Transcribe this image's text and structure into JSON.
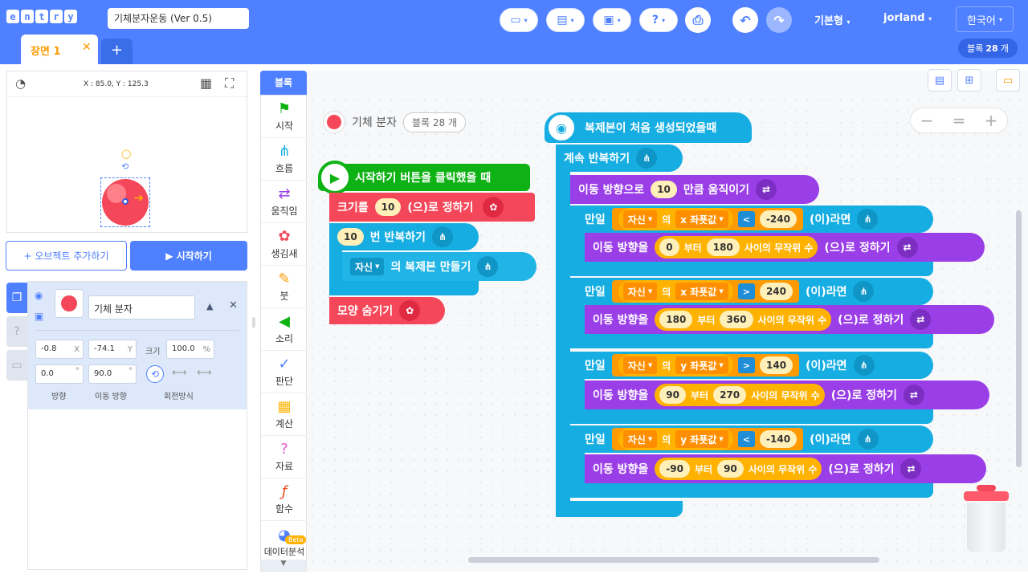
{
  "app": {
    "logo_letters": [
      "e",
      "n",
      "t",
      "r",
      "y"
    ],
    "project_title": "기체분자운동 (Ver 0.5)"
  },
  "topbar": {
    "mode_label": "기본형",
    "user_label": "jorland",
    "lang_label": "한국어",
    "help_label": "?"
  },
  "scene": {
    "tab_label": "장면 1",
    "add_label": "+",
    "block_count_prefix": "블록",
    "block_count": "28",
    "block_count_suffix": "개"
  },
  "stage": {
    "coords": "X : 85.0, Y : 125.3"
  },
  "buttons": {
    "add_object": "+ 오브젝트 추가하기",
    "start": "▶ 시작하기"
  },
  "object": {
    "name": "기체 분자",
    "x": "-0.8",
    "x_label": "X",
    "y": "-74.1",
    "y_label": "Y",
    "size_label": "크기",
    "size": "100.0",
    "size_unit": "%",
    "direction": "0.0",
    "move_direction": "90.0",
    "deg": "°",
    "direction_label": "방향",
    "move_direction_label": "이동 방향",
    "rotation_label": "회전방식"
  },
  "palette": {
    "header": "블록",
    "categories": [
      {
        "label": "시작",
        "icon": "flag-icon",
        "color": "#0fb214"
      },
      {
        "label": "흐름",
        "icon": "flow-icon",
        "color": "#16aee2"
      },
      {
        "label": "움직임",
        "icon": "move-icon",
        "color": "#9a3ee8"
      },
      {
        "label": "생김새",
        "icon": "looks-icon",
        "color": "#f4485a"
      },
      {
        "label": "붓",
        "icon": "brush-icon",
        "color": "#ff9a00"
      },
      {
        "label": "소리",
        "icon": "sound-icon",
        "color": "#0fb214"
      },
      {
        "label": "판단",
        "icon": "judge-icon",
        "color": "#4f80ff"
      },
      {
        "label": "계산",
        "icon": "calc-icon",
        "color": "#ffb200"
      },
      {
        "label": "자료",
        "icon": "data-icon",
        "color": "#e05acb"
      },
      {
        "label": "함수",
        "icon": "function-icon",
        "color": "#e74c1c"
      },
      {
        "label": "데이터분석",
        "icon": "chart-icon",
        "color": "#4f80ff"
      }
    ],
    "beta": "Beta"
  },
  "workspace": {
    "object_name": "기체 분자",
    "block_count_label": "블록 28 개",
    "zoom_out": "−",
    "zoom_reset": "=",
    "zoom_in": "+"
  },
  "script1": {
    "hat": "시작하기 버튼을 클릭했을 때",
    "size_prefix": "크기를",
    "size_val": "10",
    "size_suffix": "(으)로 정하기",
    "repeat_val": "10",
    "repeat_label": "번 반복하기",
    "clone_target": "자신",
    "clone_label": "의 복제본 만들기",
    "hide": "모양 숨기기"
  },
  "script2": {
    "hat": "복제본이 처음 생성되었을때",
    "forever": "계속 반복하기",
    "move_prefix": "이동 방향으로",
    "move_val": "10",
    "move_suffix": "만큼 움직이기",
    "if_label": "만일",
    "then_label": "(이)라면",
    "self": "자신",
    "of": "의",
    "set_dir": "이동 방향을",
    "from": "부터",
    "random": "사이의 무작위 수",
    "set_suffix": "(으)로 정하기",
    "conds": [
      {
        "coord": "x 좌푯값",
        "op": "<",
        "val": "-240",
        "lo": "0",
        "hi": "180"
      },
      {
        "coord": "x 좌푯값",
        "op": ">",
        "val": "240",
        "lo": "180",
        "hi": "360"
      },
      {
        "coord": "y 좌푯값",
        "op": ">",
        "val": "140",
        "lo": "90",
        "hi": "270"
      },
      {
        "coord": "y 좌푯값",
        "op": "<",
        "val": "-140",
        "lo": "-90",
        "hi": "90"
      }
    ]
  }
}
